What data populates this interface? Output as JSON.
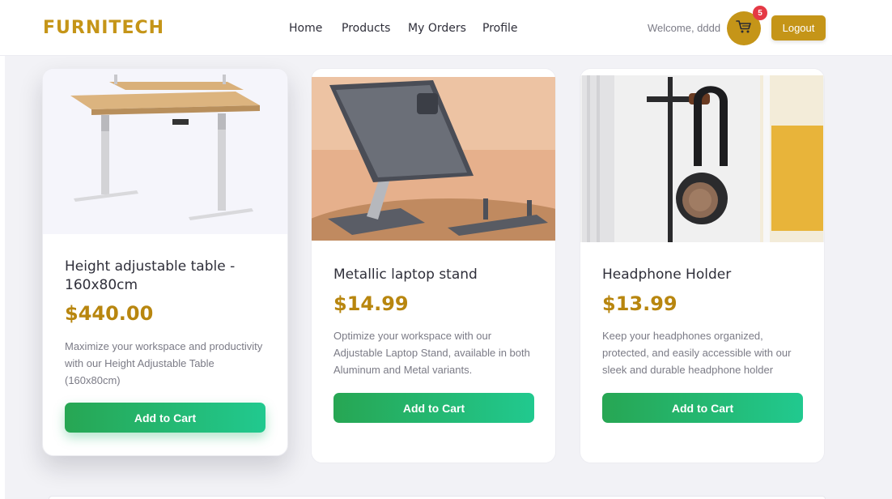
{
  "header": {
    "brand": "FURNITECH",
    "nav": [
      "Home",
      "Products",
      "My Orders",
      "Profile"
    ],
    "welcome": "Welcome, dddd",
    "cart_count": "5",
    "logout_label": "Logout"
  },
  "products": [
    {
      "title": "Height adjustable table - 160x80cm",
      "price": "$440.00",
      "description": "Maximize your workspace and productivity with our Height Adjustable Table (160x80cm)",
      "button": "Add to Cart"
    },
    {
      "title": "Metallic laptop stand",
      "price": "$14.99",
      "description": "Optimize your workspace with our Adjustable Laptop Stand, available in both Aluminum and Metal variants.",
      "button": "Add to Cart"
    },
    {
      "title": "Headphone Holder",
      "price": "$13.99",
      "description": "Keep your headphones organized, protected, and easily accessible with our sleek and durable headphone holder",
      "button": "Add to Cart"
    }
  ],
  "colors": {
    "brand": "#c59518",
    "price": "#b8860f",
    "badge": "#e53945",
    "button_start": "#27a653",
    "button_end": "#21c98f"
  },
  "icons": [
    "cart-icon"
  ]
}
